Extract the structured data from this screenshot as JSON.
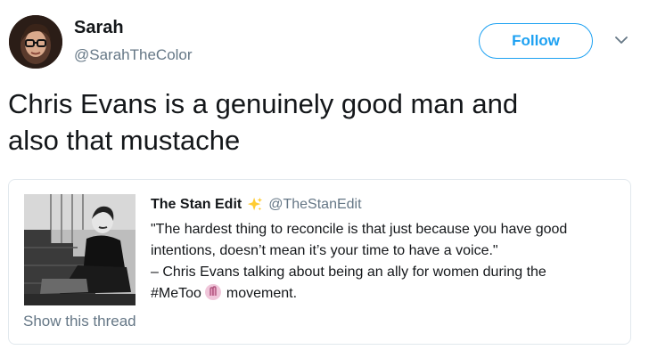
{
  "tweet": {
    "author": {
      "display_name": "Sarah",
      "handle": "@SarahTheColor",
      "avatar_icon": "user-avatar"
    },
    "follow_label": "Follow",
    "menu_icon": "chevron-down-icon",
    "text_lines": [
      "Chris Evans is a genuinely good man and",
      "also that mustache"
    ]
  },
  "quoted_tweet": {
    "author": {
      "display_name": "The Stan Edit",
      "handle": "@TheStanEdit",
      "badge_icon": "sparkles-icon"
    },
    "body_lines": [
      "\"The hardest thing to reconcile is that just because you have good",
      "intentions, doesn’t mean it’s your time to have a voice.\"",
      "– Chris Evans talking about being an ally for women during the"
    ],
    "last_line": {
      "hashtag": "#MeToo",
      "emoji_icon": "metoo-emoji-icon",
      "tail": "movement."
    },
    "image_icon": "photo-thumbnail",
    "show_thread_label": "Show this thread"
  },
  "colors": {
    "accent": "#1da1f2",
    "text": "#14171a",
    "muted": "#657786",
    "border": "#e1e8ed"
  }
}
